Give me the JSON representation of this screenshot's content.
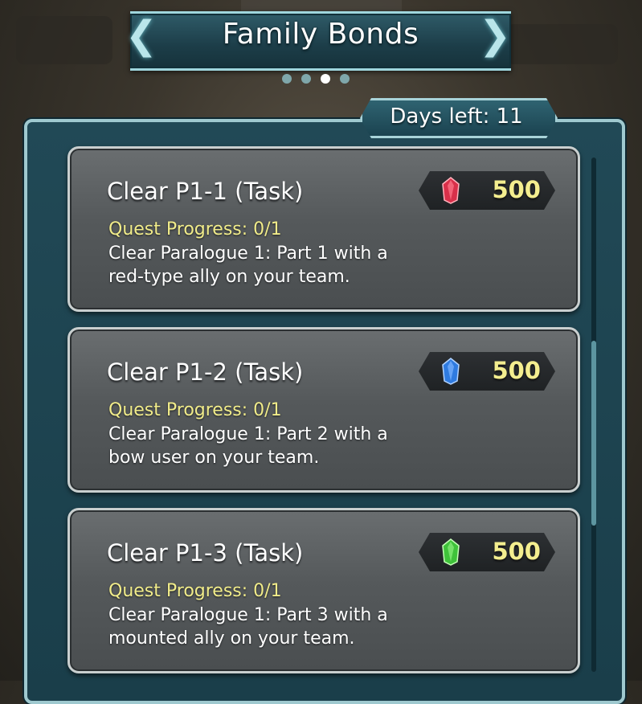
{
  "header": {
    "title": "Family Bonds",
    "page_count": 4,
    "active_page": 3
  },
  "days_left": "Days left: 11",
  "quests": [
    {
      "title": "Clear P1-1 (Task)",
      "progress": "Quest Progress: 0/1",
      "description": "Clear Paralogue 1: Part 1 with a red-type ally on your team.",
      "reward_amount": "500",
      "reward_icon": "red-orb-icon",
      "orb_color": "#d8304a"
    },
    {
      "title": "Clear P1-2 (Task)",
      "progress": "Quest Progress: 0/1",
      "description": "Clear Paralogue 1: Part 2 with a bow user on your team.",
      "reward_amount": "500",
      "reward_icon": "blue-orb-icon",
      "orb_color": "#2f7be0"
    },
    {
      "title": "Clear P1-3 (Task)",
      "progress": "Quest Progress: 0/1",
      "description": "Clear Paralogue 1: Part 3 with a mounted ally on your team.",
      "reward_amount": "500",
      "reward_icon": "green-orb-icon",
      "orb_color": "#3fc23a"
    }
  ]
}
